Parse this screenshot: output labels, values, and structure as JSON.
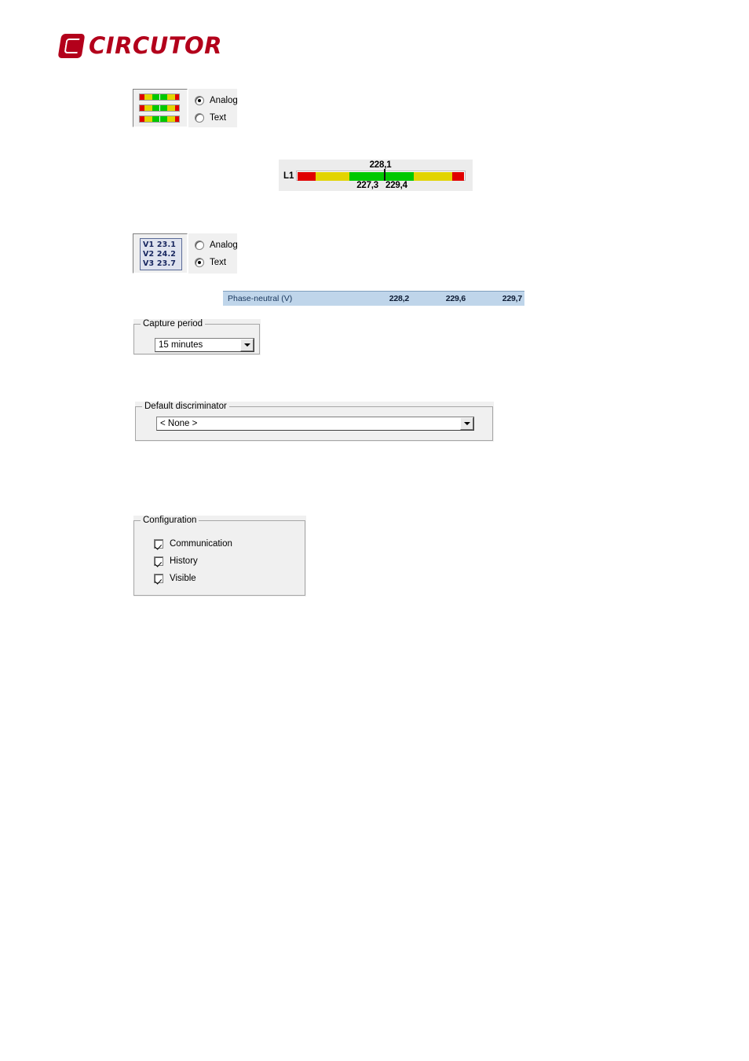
{
  "brand": {
    "name": "CIRCUTOR",
    "logo_icon": "circutor-c-mark",
    "color": "#b3001b"
  },
  "display_mode_analog": {
    "preview_icon": "analog-bargraph-preview",
    "options": [
      {
        "label": "Analog",
        "selected": true
      },
      {
        "label": "Text",
        "selected": false
      }
    ]
  },
  "display_mode_text": {
    "preview_icon": "text-values-preview",
    "preview_lines": [
      "V1 23.1",
      "V2 24.2",
      "V3 23.7"
    ],
    "options": [
      {
        "label": "Analog",
        "selected": false
      },
      {
        "label": "Text",
        "selected": true
      }
    ]
  },
  "analog_gauge": {
    "phase_label": "L1",
    "current_value": "228,1",
    "min_value": "227,3",
    "max_value": "229,4",
    "marker_percent": 52,
    "segments": [
      {
        "color": "#e00000",
        "percent": 11
      },
      {
        "color": "#e2d400",
        "percent": 20
      },
      {
        "color": "#00c800",
        "percent": 39
      },
      {
        "color": "#e2d400",
        "percent": 23
      },
      {
        "color": "#e00000",
        "percent": 7
      }
    ]
  },
  "text_row": {
    "name": "Phase-neutral (V)",
    "values": [
      "228,2",
      "229,6",
      "229,7"
    ]
  },
  "capture_period": {
    "title": "Capture period",
    "selected": "15 minutes"
  },
  "default_discriminator": {
    "title": "Default discriminator",
    "selected": "< None >"
  },
  "configuration": {
    "title": "Configuration",
    "items": [
      {
        "label": "Communication",
        "checked": true
      },
      {
        "label": "History",
        "checked": true
      },
      {
        "label": "Visible",
        "checked": true
      }
    ]
  }
}
